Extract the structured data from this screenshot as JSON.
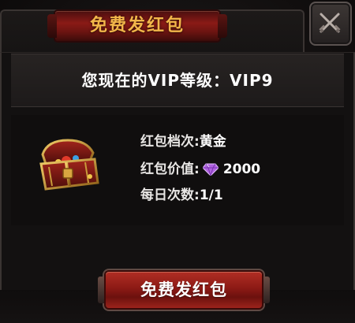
{
  "dialog": {
    "title": "免费发红包",
    "vip_text": "您现在的VIP等级：VIP9"
  },
  "envelope": {
    "tier_label": "红包档次:",
    "tier_value": "黄金",
    "value_label": "红包价值:",
    "value_amount": "2000",
    "daily_label": "每日次数:",
    "daily_value": "1/1"
  },
  "actions": {
    "claim_label": "免费发红包"
  },
  "icons": {
    "close": "close-crossed-swords-icon",
    "chest": "treasure-chest-icon",
    "gem": "purple-diamond-icon"
  },
  "colors": {
    "title_gold": "#f2b64a",
    "banner_red": "#8a1a16",
    "button_red": "#b12e24",
    "gem_purple": "#b062e0",
    "text_white": "#ffffff"
  }
}
